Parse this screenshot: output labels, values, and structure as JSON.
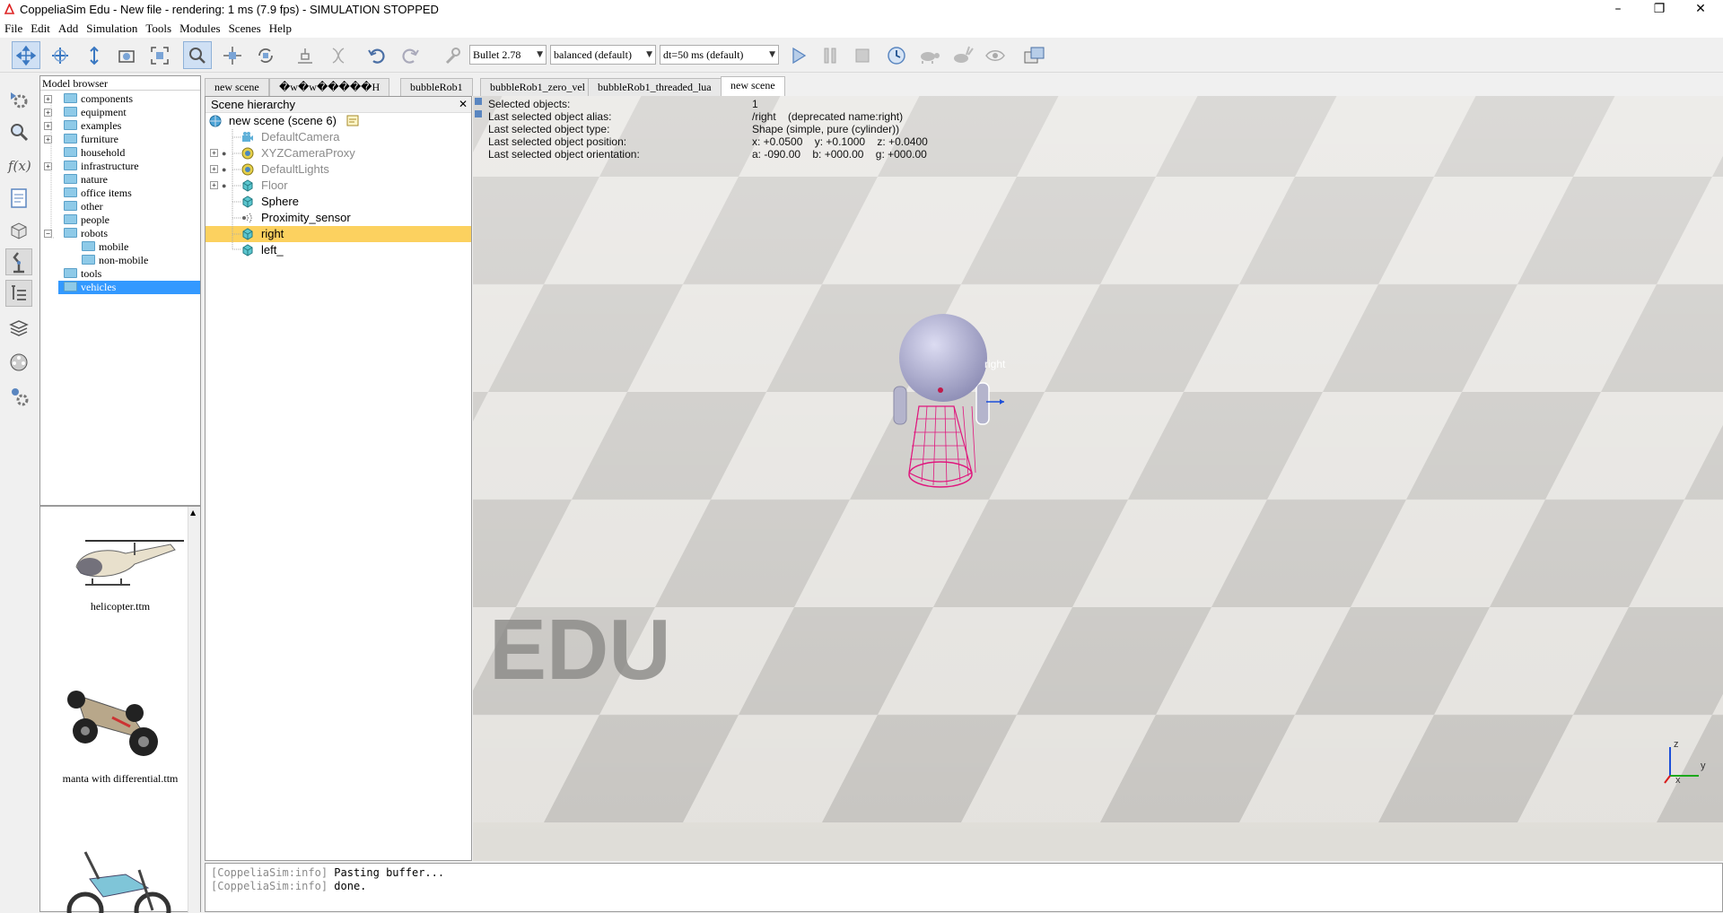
{
  "window": {
    "title": "CoppeliaSim Edu - New file - rendering: 1 ms (7.9 fps) - SIMULATION STOPPED",
    "minimize": "–",
    "restore": "❐",
    "close": "✕"
  },
  "menu": [
    "File",
    "Edit",
    "Add",
    "Simulation",
    "Tools",
    "Modules",
    "Scenes",
    "Help"
  ],
  "toolbar": {
    "engine": "Bullet 2.78",
    "accuracy": "balanced (default)",
    "timestep": "dt=50 ms (default)"
  },
  "model_browser": {
    "title": "Model browser",
    "items": [
      {
        "label": "components"
      },
      {
        "label": "equipment"
      },
      {
        "label": "examples"
      },
      {
        "label": "furniture"
      },
      {
        "label": "household"
      },
      {
        "label": "infrastructure"
      },
      {
        "label": "nature"
      },
      {
        "label": "office items"
      },
      {
        "label": "other"
      },
      {
        "label": "people"
      },
      {
        "label": "robots"
      },
      {
        "label": "mobile"
      },
      {
        "label": "non-mobile"
      },
      {
        "label": "tools"
      },
      {
        "label": "vehicles"
      }
    ],
    "thumbnails": [
      {
        "label": "helicopter.ttm"
      },
      {
        "label": "manta with differential.ttm"
      }
    ]
  },
  "scene_tabs": [
    "new scene",
    "�w�w�����H",
    "bubbleRob1",
    "bubbleRob1_zero_vel",
    "bubbleRob1_threaded_lua",
    "new scene"
  ],
  "hierarchy": {
    "title": "Scene hierarchy",
    "close": "✕",
    "root": "new scene (scene 6)",
    "items": [
      {
        "label": "DefaultCamera"
      },
      {
        "label": "XYZCameraProxy"
      },
      {
        "label": "DefaultLights"
      },
      {
        "label": "Floor"
      },
      {
        "label": "Sphere"
      },
      {
        "label": "Proximity_sensor"
      },
      {
        "label": "right"
      },
      {
        "label": "left_"
      }
    ]
  },
  "viewport": {
    "info_labels": [
      "Selected objects:",
      "Last selected object alias:",
      "Last selected object type:",
      "Last selected object position:",
      "Last selected object orientation:"
    ],
    "info_values": [
      "1",
      "/right    (deprecated name:right)",
      "Shape (simple, pure (cylinder))",
      "x: +0.0500    y: +0.1000    z: +0.0400",
      "a: -090.00    b: +000.00    g: +000.00"
    ],
    "object_label": "right",
    "watermark": "EDU",
    "axis_z": "z",
    "axis_y": "y",
    "axis_x": "x"
  },
  "console": [
    {
      "prefix": "[CoppeliaSim:info]",
      "text": "Pasting buffer..."
    },
    {
      "prefix": "[CoppeliaSim:info]",
      "text": "done."
    }
  ]
}
